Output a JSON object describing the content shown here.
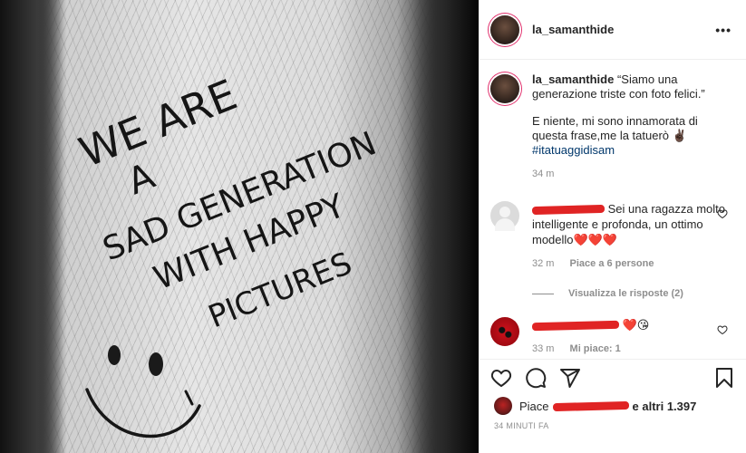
{
  "post": {
    "username": "la_samanthide",
    "more_label": "•••"
  },
  "caption": {
    "username": "la_samanthide",
    "line1": " “Siamo una generazione triste con foto felici.”",
    "line2": "E niente, mi sono innamorata di questa frase,me la tatuerò ✌🏿",
    "hashtag": "#itatuaggidisam",
    "time": "34 m"
  },
  "comments": [
    {
      "text": "Sei una ragazza molto intelligente e profonda, un ottimo modello",
      "emoji": "❤️❤️❤️",
      "time": "32 m",
      "action": "Piace a 6 persone",
      "replies_label": "Visualizza le risposte (2)"
    },
    {
      "emoji": "❤️😘",
      "time": "33 m",
      "action": "Mi piace: 1"
    }
  ],
  "likes": {
    "prefix": "Piace",
    "suffix": "e altri 1.397"
  },
  "timestamp": "34 MINUTI FA",
  "tattoo": {
    "line1": "WE ARE",
    "line2": "A",
    "line3": "SAD GENERATION",
    "line4": "WITH HAPPY",
    "line5": "PICTURES"
  },
  "colors": {
    "redaction": "#e02424",
    "link": "#00376b",
    "muted": "#8e8e8e",
    "heart": "#ed4956"
  },
  "icons": [
    "heart-icon",
    "comment-icon",
    "share-icon",
    "bookmark-icon",
    "more-icon"
  ]
}
